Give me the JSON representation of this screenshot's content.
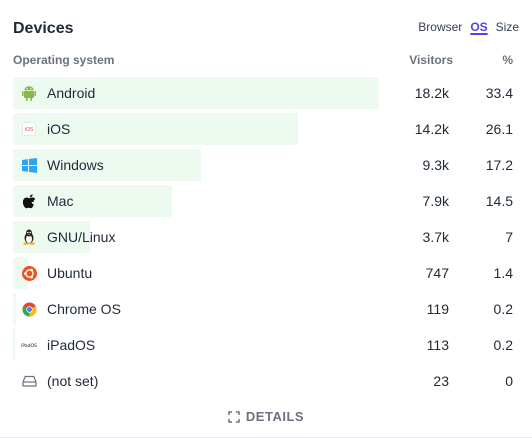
{
  "header": {
    "title": "Devices",
    "tabs": [
      "Browser",
      "OS",
      "Size"
    ]
  },
  "columns": {
    "name": "Operating system",
    "visitors": "Visitors",
    "percent": "%"
  },
  "rows": [
    {
      "name": "Android",
      "visitors": "18.2k",
      "percent": "33.4",
      "icon": "android-icon",
      "bar_fraction": 1.0
    },
    {
      "name": "iOS",
      "visitors": "14.2k",
      "percent": "26.1",
      "icon": "ios-icon",
      "bar_fraction": 0.78
    },
    {
      "name": "Windows",
      "visitors": "9.3k",
      "percent": "17.2",
      "icon": "windows-icon",
      "bar_fraction": 0.515
    },
    {
      "name": "Mac",
      "visitors": "7.9k",
      "percent": "14.5",
      "icon": "apple-icon",
      "bar_fraction": 0.434
    },
    {
      "name": "GNU/Linux",
      "visitors": "3.7k",
      "percent": "7",
      "icon": "linux-icon",
      "bar_fraction": 0.21
    },
    {
      "name": "Ubuntu",
      "visitors": "747",
      "percent": "1.4",
      "icon": "ubuntu-icon",
      "bar_fraction": 0.042
    },
    {
      "name": "Chrome OS",
      "visitors": "119",
      "percent": "0.2",
      "icon": "chrome-icon",
      "bar_fraction": 0.007
    },
    {
      "name": "iPadOS",
      "visitors": "113",
      "percent": "0.2",
      "icon": "ipados-icon",
      "bar_fraction": 0.006
    },
    {
      "name": "(not set)",
      "visitors": "23",
      "percent": "0",
      "icon": "hard-drive-icon",
      "bar_fraction": 0.001
    }
  ],
  "footer": {
    "details_label": "DETAILS"
  },
  "colors": {
    "bar": "#edfaf0",
    "active_tab": "#4f46e5"
  }
}
